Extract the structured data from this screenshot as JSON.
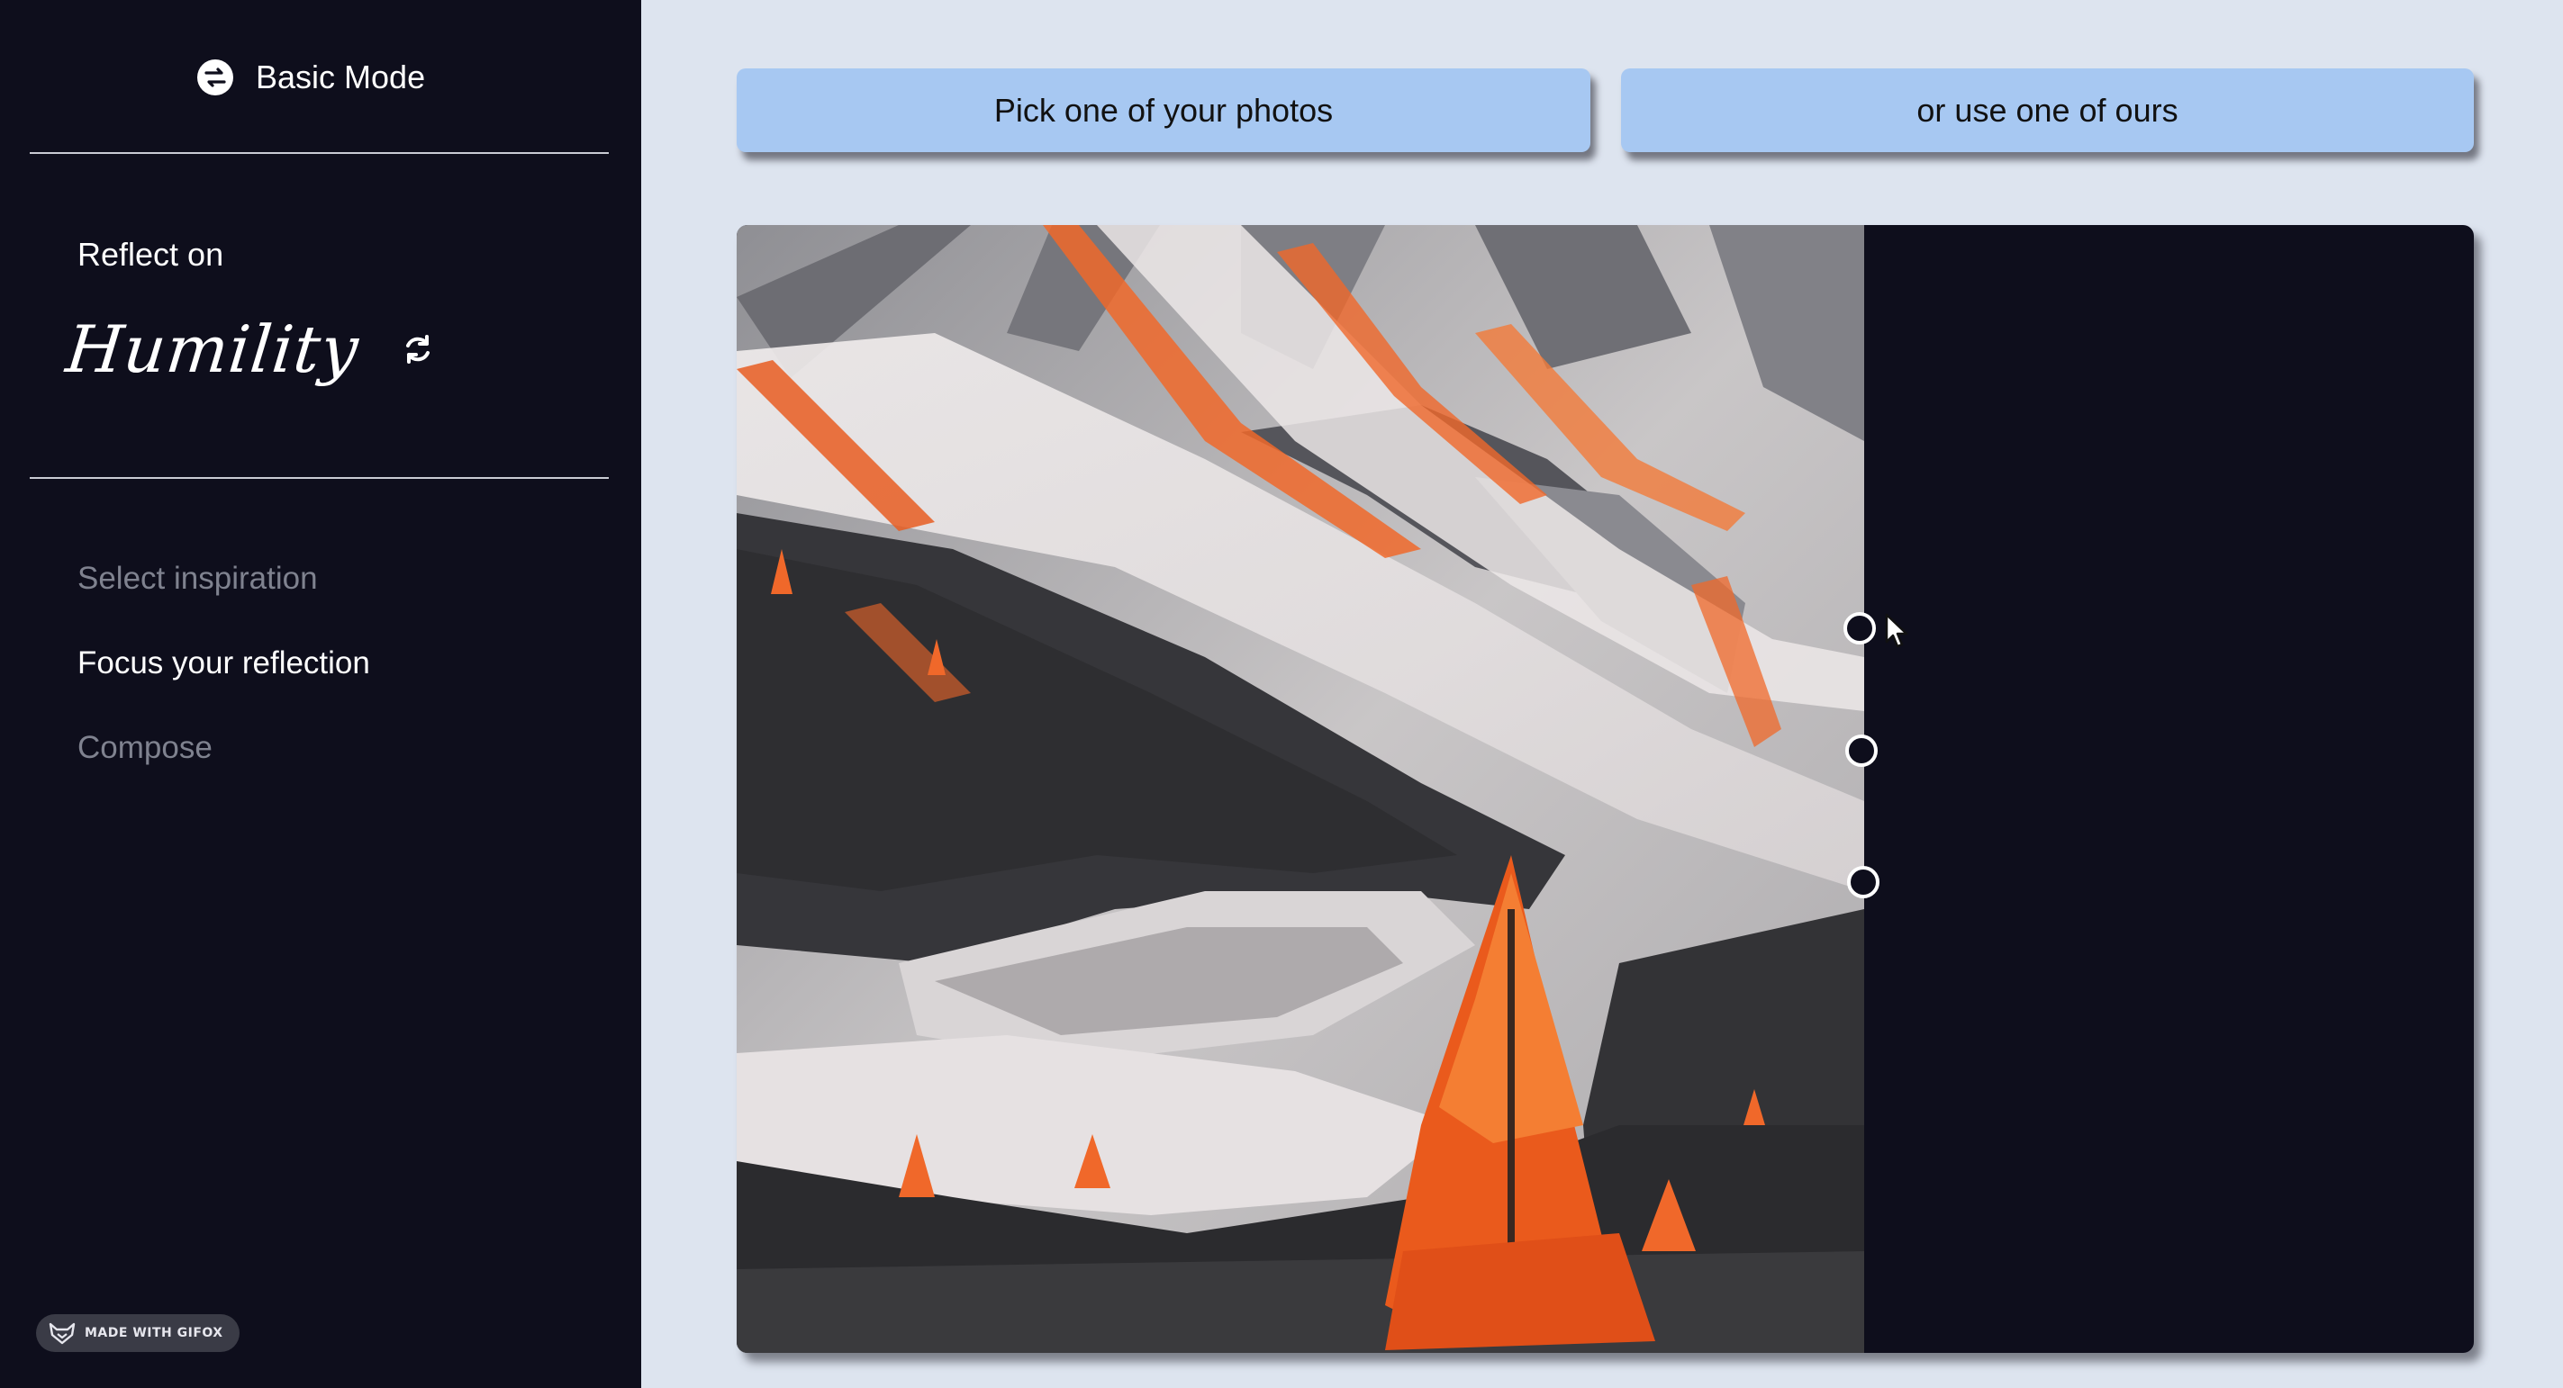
{
  "sidebar": {
    "mode_toggle": {
      "label": "Basic Mode",
      "icon": "swap-icon"
    },
    "reflect_label": "Reflect on",
    "virtue": "Humility",
    "refresh_icon": "refresh-icon",
    "steps": [
      {
        "label": "Select inspiration",
        "state": "inactive"
      },
      {
        "label": "Focus your reflection",
        "state": "active"
      },
      {
        "label": "Compose",
        "state": "inactive"
      }
    ],
    "watermark": "MADE WITH GIFOX"
  },
  "main": {
    "buttons": {
      "pick_own": "Pick one of your photos",
      "use_ours": "or use one of ours"
    },
    "canvas": {
      "image": "mountain slope with orange larch trees",
      "handles": [
        "crop-handle",
        "crop-handle",
        "crop-handle"
      ]
    }
  },
  "colors": {
    "sidebar_bg": "#0e0e1c",
    "page_bg": "#dde4ef",
    "button_bg": "#a7c8f2",
    "inactive_text": "#7f828f",
    "accent_orange": "#f0682a"
  }
}
